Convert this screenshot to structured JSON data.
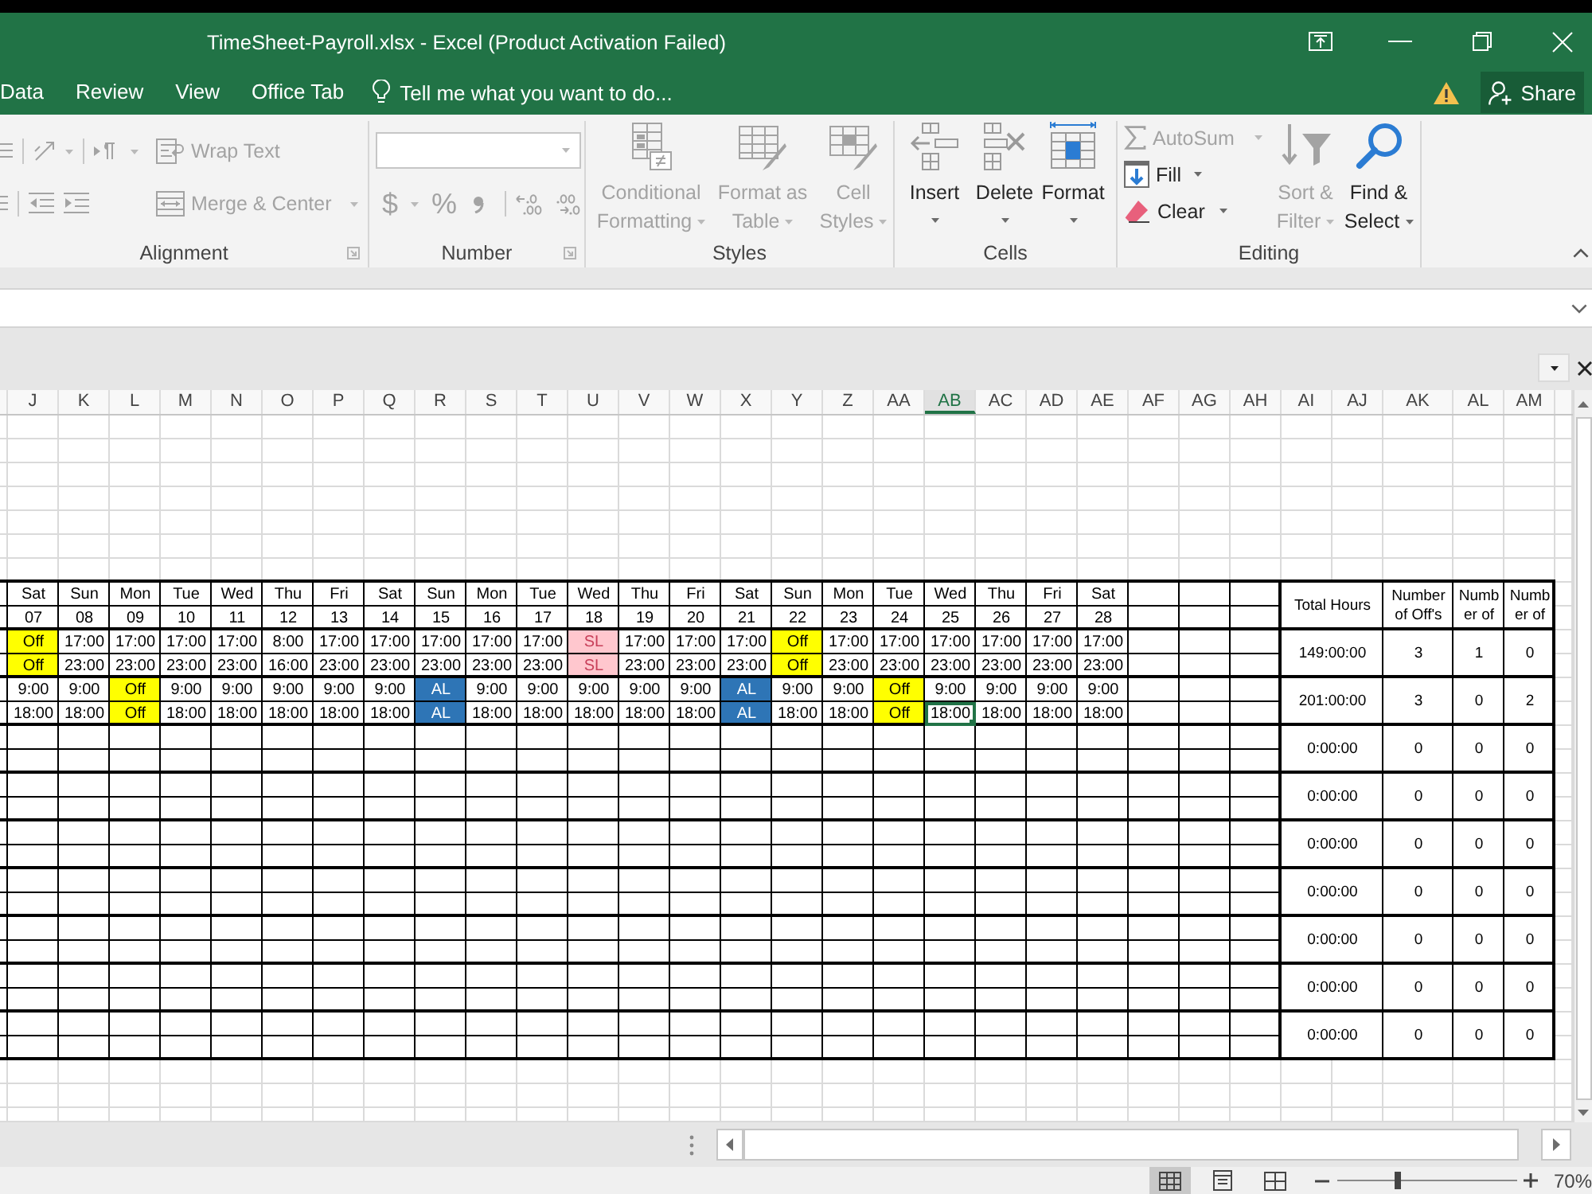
{
  "window": {
    "title": "TimeSheet-Payroll.xlsx - Excel (Product Activation Failed)"
  },
  "ribbon_tabs": [
    {
      "label": "Data",
      "selected": false
    },
    {
      "label": "Review",
      "selected": false
    },
    {
      "label": "View",
      "selected": false
    },
    {
      "label": "Office Tab",
      "selected": false
    }
  ],
  "tell_me": {
    "placeholder": "Tell me what you want to do..."
  },
  "share_button": {
    "label": "Share"
  },
  "ribbon": {
    "alignment": {
      "label": "Alignment",
      "cut_off_buttons": [
        {
          "disabled": true
        },
        {
          "disabled": true
        }
      ],
      "orientation": {
        "disabled": true
      },
      "text_direction": {
        "disabled": true
      },
      "wrap_text": {
        "label": "Wrap Text",
        "disabled": true
      },
      "decrease_indent": {
        "disabled": true
      },
      "increase_indent": {
        "disabled": true
      },
      "merge_center": {
        "label": "Merge & Center",
        "disabled": true
      }
    },
    "number": {
      "label": "Number",
      "format": {
        "disabled": true
      },
      "currency": {
        "symbol": "$",
        "disabled": true
      },
      "percent": {
        "symbol": "%",
        "disabled": true
      },
      "comma": {
        "disabled": true
      },
      "increase_decimal": {
        "disabled": true
      },
      "decrease_decimal": {
        "disabled": true
      }
    },
    "styles": {
      "label": "Styles",
      "conditional_formatting": {
        "label": "Conditional Formatting",
        "disabled": true
      },
      "format_as_table": {
        "label": "Format as Table",
        "disabled": true
      },
      "cell_styles": {
        "label": "Cell Styles",
        "disabled": true
      }
    },
    "cells": {
      "label": "Cells",
      "insert": {
        "label": "Insert",
        "disabled": false
      },
      "delete": {
        "label": "Delete",
        "disabled": false
      },
      "format": {
        "label": "Format",
        "disabled": false
      }
    },
    "editing": {
      "label": "Editing",
      "autosum": {
        "label": "AutoSum",
        "disabled": true
      },
      "fill": {
        "label": "Fill",
        "disabled": false
      },
      "clear": {
        "label": "Clear",
        "disabled": false
      },
      "sort_filter": {
        "label": "Sort & Filter",
        "disabled": true
      },
      "find_select": {
        "label": "Find & Select",
        "disabled": false
      }
    }
  },
  "sheet": {
    "columns": [
      {
        "label": "J",
        "selected": false
      },
      {
        "label": "K",
        "selected": false
      },
      {
        "label": "L",
        "selected": false
      },
      {
        "label": "M",
        "selected": false
      },
      {
        "label": "N",
        "selected": false
      },
      {
        "label": "O",
        "selected": false
      },
      {
        "label": "P",
        "selected": false
      },
      {
        "label": "Q",
        "selected": false
      },
      {
        "label": "R",
        "selected": false
      },
      {
        "label": "S",
        "selected": false
      },
      {
        "label": "T",
        "selected": false
      },
      {
        "label": "U",
        "selected": false
      },
      {
        "label": "V",
        "selected": false
      },
      {
        "label": "W",
        "selected": false
      },
      {
        "label": "X",
        "selected": false
      },
      {
        "label": "Y",
        "selected": false
      },
      {
        "label": "Z",
        "selected": false
      },
      {
        "label": "AA",
        "selected": false
      },
      {
        "label": "AB",
        "selected": true
      },
      {
        "label": "AC",
        "selected": false
      },
      {
        "label": "AD",
        "selected": false
      },
      {
        "label": "AE",
        "selected": false
      },
      {
        "label": "AF",
        "selected": false
      },
      {
        "label": "AG",
        "selected": false
      },
      {
        "label": "AH",
        "selected": false
      },
      {
        "label": "AI",
        "selected": false
      },
      {
        "label": "AJ",
        "selected": false
      },
      {
        "label": "AK",
        "selected": false
      },
      {
        "label": "AL",
        "selected": false
      },
      {
        "label": "AM",
        "selected": false
      }
    ],
    "schedule_header": {
      "days": [
        "Sat",
        "Sun",
        "Mon",
        "Tue",
        "Wed",
        "Thu",
        "Fri",
        "Sat",
        "Sun",
        "Mon",
        "Tue",
        "Wed",
        "Thu",
        "Fri",
        "Sat",
        "Sun",
        "Mon",
        "Tue",
        "Wed",
        "Thu",
        "Fri",
        "Sat"
      ],
      "dates": [
        "07",
        "08",
        "09",
        "10",
        "11",
        "12",
        "13",
        "14",
        "15",
        "16",
        "17",
        "18",
        "19",
        "20",
        "21",
        "22",
        "23",
        "24",
        "25",
        "26",
        "27",
        "28"
      ]
    },
    "summary_headings": [
      "Total Hours",
      "Number\nof Off's",
      "Numb\ner of",
      "Numb\ner of"
    ],
    "employees": [
      {
        "shifts": [
          [
            {
              "text": "Off",
              "kind": "off",
              "selected": false
            },
            {
              "text": "17:00",
              "kind": "time",
              "selected": false
            },
            {
              "text": "17:00",
              "kind": "time",
              "selected": false
            },
            {
              "text": "17:00",
              "kind": "time",
              "selected": false
            },
            {
              "text": "17:00",
              "kind": "time",
              "selected": false
            },
            {
              "text": "8:00",
              "kind": "time",
              "selected": false
            },
            {
              "text": "17:00",
              "kind": "time",
              "selected": false
            },
            {
              "text": "17:00",
              "kind": "time",
              "selected": false
            },
            {
              "text": "17:00",
              "kind": "time",
              "selected": false
            },
            {
              "text": "17:00",
              "kind": "time",
              "selected": false
            },
            {
              "text": "17:00",
              "kind": "time",
              "selected": false
            },
            {
              "text": "SL",
              "kind": "sick_leave",
              "selected": false
            },
            {
              "text": "17:00",
              "kind": "time",
              "selected": false
            },
            {
              "text": "17:00",
              "kind": "time",
              "selected": false
            },
            {
              "text": "17:00",
              "kind": "time",
              "selected": false
            },
            {
              "text": "Off",
              "kind": "off",
              "selected": false
            },
            {
              "text": "17:00",
              "kind": "time",
              "selected": false
            },
            {
              "text": "17:00",
              "kind": "time",
              "selected": false
            },
            {
              "text": "17:00",
              "kind": "time",
              "selected": false
            },
            {
              "text": "17:00",
              "kind": "time",
              "selected": false
            },
            {
              "text": "17:00",
              "kind": "time",
              "selected": false
            },
            {
              "text": "17:00",
              "kind": "time",
              "selected": false
            }
          ],
          [
            {
              "text": "Off",
              "kind": "off",
              "selected": false
            },
            {
              "text": "23:00",
              "kind": "time",
              "selected": false
            },
            {
              "text": "23:00",
              "kind": "time",
              "selected": false
            },
            {
              "text": "23:00",
              "kind": "time",
              "selected": false
            },
            {
              "text": "23:00",
              "kind": "time",
              "selected": false
            },
            {
              "text": "16:00",
              "kind": "time",
              "selected": false
            },
            {
              "text": "23:00",
              "kind": "time",
              "selected": false
            },
            {
              "text": "23:00",
              "kind": "time",
              "selected": false
            },
            {
              "text": "23:00",
              "kind": "time",
              "selected": false
            },
            {
              "text": "23:00",
              "kind": "time",
              "selected": false
            },
            {
              "text": "23:00",
              "kind": "time",
              "selected": false
            },
            {
              "text": "SL",
              "kind": "sick_leave",
              "selected": false
            },
            {
              "text": "23:00",
              "kind": "time",
              "selected": false
            },
            {
              "text": "23:00",
              "kind": "time",
              "selected": false
            },
            {
              "text": "23:00",
              "kind": "time",
              "selected": false
            },
            {
              "text": "Off",
              "kind": "off",
              "selected": false
            },
            {
              "text": "23:00",
              "kind": "time",
              "selected": false
            },
            {
              "text": "23:00",
              "kind": "time",
              "selected": false
            },
            {
              "text": "23:00",
              "kind": "time",
              "selected": false
            },
            {
              "text": "23:00",
              "kind": "time",
              "selected": false
            },
            {
              "text": "23:00",
              "kind": "time",
              "selected": false
            },
            {
              "text": "23:00",
              "kind": "time",
              "selected": false
            }
          ]
        ],
        "summary": [
          "149:00:00",
          "3",
          "1",
          "0"
        ]
      },
      {
        "shifts": [
          [
            {
              "text": "9:00",
              "kind": "time",
              "selected": false
            },
            {
              "text": "9:00",
              "kind": "time",
              "selected": false
            },
            {
              "text": "Off",
              "kind": "off",
              "selected": false
            },
            {
              "text": "9:00",
              "kind": "time",
              "selected": false
            },
            {
              "text": "9:00",
              "kind": "time",
              "selected": false
            },
            {
              "text": "9:00",
              "kind": "time",
              "selected": false
            },
            {
              "text": "9:00",
              "kind": "time",
              "selected": false
            },
            {
              "text": "9:00",
              "kind": "time",
              "selected": false
            },
            {
              "text": "AL",
              "kind": "annual_leave",
              "selected": false
            },
            {
              "text": "9:00",
              "kind": "time",
              "selected": false
            },
            {
              "text": "9:00",
              "kind": "time",
              "selected": false
            },
            {
              "text": "9:00",
              "kind": "time",
              "selected": false
            },
            {
              "text": "9:00",
              "kind": "time",
              "selected": false
            },
            {
              "text": "9:00",
              "kind": "time",
              "selected": false
            },
            {
              "text": "AL",
              "kind": "annual_leave",
              "selected": false
            },
            {
              "text": "9:00",
              "kind": "time",
              "selected": false
            },
            {
              "text": "9:00",
              "kind": "time",
              "selected": false
            },
            {
              "text": "Off",
              "kind": "off",
              "selected": false
            },
            {
              "text": "9:00",
              "kind": "time",
              "selected": false
            },
            {
              "text": "9:00",
              "kind": "time",
              "selected": false
            },
            {
              "text": "9:00",
              "kind": "time",
              "selected": false
            },
            {
              "text": "9:00",
              "kind": "time",
              "selected": false
            }
          ],
          [
            {
              "text": "18:00",
              "kind": "time",
              "selected": false
            },
            {
              "text": "18:00",
              "kind": "time",
              "selected": false
            },
            {
              "text": "Off",
              "kind": "off",
              "selected": false
            },
            {
              "text": "18:00",
              "kind": "time",
              "selected": false
            },
            {
              "text": "18:00",
              "kind": "time",
              "selected": false
            },
            {
              "text": "18:00",
              "kind": "time",
              "selected": false
            },
            {
              "text": "18:00",
              "kind": "time",
              "selected": false
            },
            {
              "text": "18:00",
              "kind": "time",
              "selected": false
            },
            {
              "text": "AL",
              "kind": "annual_leave",
              "selected": false
            },
            {
              "text": "18:00",
              "kind": "time",
              "selected": false
            },
            {
              "text": "18:00",
              "kind": "time",
              "selected": false
            },
            {
              "text": "18:00",
              "kind": "time",
              "selected": false
            },
            {
              "text": "18:00",
              "kind": "time",
              "selected": false
            },
            {
              "text": "18:00",
              "kind": "time",
              "selected": false
            },
            {
              "text": "AL",
              "kind": "annual_leave",
              "selected": false
            },
            {
              "text": "18:00",
              "kind": "time",
              "selected": false
            },
            {
              "text": "18:00",
              "kind": "time",
              "selected": false
            },
            {
              "text": "Off",
              "kind": "off",
              "selected": false
            },
            {
              "text": "18:00",
              "kind": "time",
              "selected": true
            },
            {
              "text": "18:00",
              "kind": "time",
              "selected": false
            },
            {
              "text": "18:00",
              "kind": "time",
              "selected": false
            },
            {
              "text": "18:00",
              "kind": "time",
              "selected": false
            }
          ]
        ],
        "summary": [
          "201:00:00",
          "3",
          "0",
          "2"
        ]
      },
      {
        "summary": [
          "0:00:00",
          "0",
          "0",
          "0"
        ]
      },
      {
        "summary": [
          "0:00:00",
          "0",
          "0",
          "0"
        ]
      },
      {
        "summary": [
          "0:00:00",
          "0",
          "0",
          "0"
        ]
      },
      {
        "summary": [
          "0:00:00",
          "0",
          "0",
          "0"
        ]
      },
      {
        "summary": [
          "0:00:00",
          "0",
          "0",
          "0"
        ]
      },
      {
        "summary": [
          "0:00:00",
          "0",
          "0",
          "0"
        ]
      },
      {
        "summary": [
          "0:00:00",
          "0",
          "0",
          "0"
        ]
      }
    ]
  },
  "status_bar": {
    "view_buttons": [
      {
        "kind": "normal",
        "selected": true
      },
      {
        "kind": "page_layout",
        "selected": false
      },
      {
        "kind": "page_break_preview",
        "selected": false
      }
    ],
    "zoom": {
      "level": 0.34,
      "reading": "70%"
    }
  }
}
